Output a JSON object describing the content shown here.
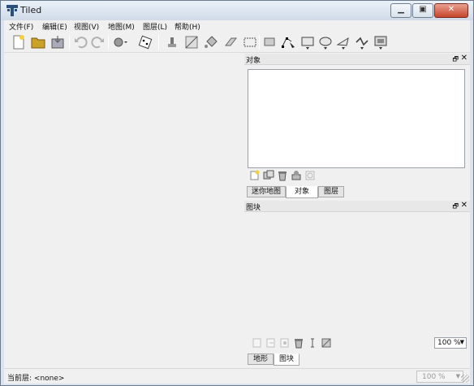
{
  "window": {
    "title": "Tiled",
    "min_glyph": "▁",
    "max_glyph": "▣",
    "close_glyph": "✕"
  },
  "menubar": [
    {
      "label": "文件(F)"
    },
    {
      "label": "编辑(E)"
    },
    {
      "label": "视图(V)"
    },
    {
      "label": "地图(M)"
    },
    {
      "label": "图层(L)"
    },
    {
      "label": "帮助(H)"
    }
  ],
  "toolbar": {
    "icons": [
      "new-icon",
      "open-icon",
      "save-icon",
      "undo-icon",
      "redo-icon",
      "stamp-brush-icon",
      "random-icon",
      "bucket-fill-icon",
      "eraser-icon",
      "rect-select-icon",
      "select-objects-icon",
      "edit-polygons-icon",
      "insert-rectangle-icon",
      "insert-ellipse-icon",
      "insert-polygon-icon",
      "insert-polyline-icon",
      "insert-tile-icon"
    ]
  },
  "objects_dock": {
    "title": "对象",
    "float_glyph": "🗗",
    "close_glyph": "✕",
    "tabs": [
      "迷你地图",
      "对象",
      "图层"
    ],
    "active_tab": "对象"
  },
  "tilesets_dock": {
    "title": "图块",
    "float_glyph": "🗗",
    "close_glyph": "✕",
    "zoom": "100 %",
    "tabs": [
      "地形",
      "图块"
    ],
    "active_tab": "图块"
  },
  "status": {
    "layer_label": "当前层:",
    "layer_value": "<none>",
    "zoom": "100 %"
  },
  "colors": {
    "accent": "#3a6ea5",
    "window_bg": "#f0f0f0",
    "titlebar": "#dbe4ee"
  }
}
